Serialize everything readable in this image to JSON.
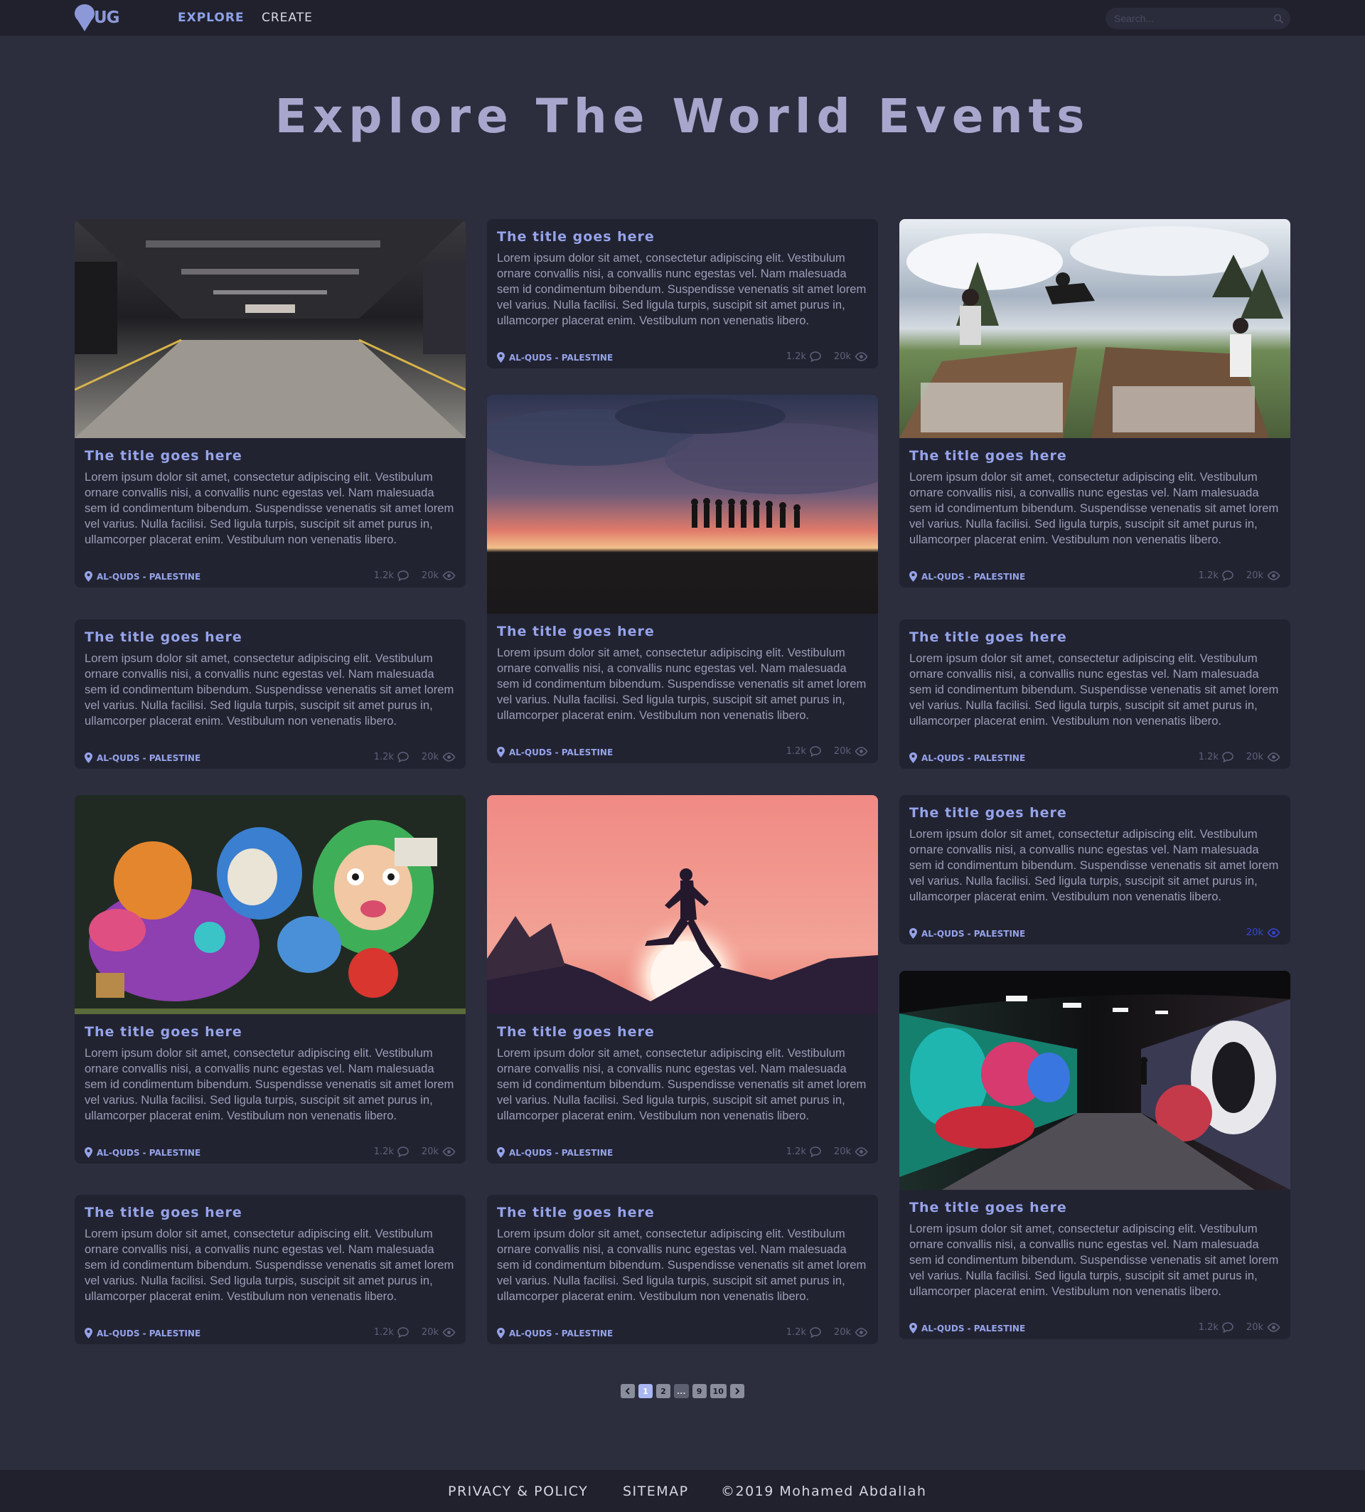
{
  "nav": {
    "brand": "UG",
    "links": [
      "EXPLORE",
      "CREATE"
    ],
    "active": "EXPLORE",
    "search_placeholder": "Search..."
  },
  "hero": {
    "title": "Explore The World Events"
  },
  "colors": {
    "background": "#2c2d3d",
    "card": "#222331",
    "accent": "#95a3ea",
    "title": "#a8a6cc",
    "highlight": "#3546d6"
  },
  "cards": [
    {
      "image": "parking-garage",
      "title": "The title goes here",
      "text": "Lorem ipsum dolor sit amet, consectetur adipiscing elit. Vestibulum ornare convallis nisi, a convallis nunc egestas vel. Nam malesuada sem id condimentum bibendum. Suspendisse venenatis sit amet lorem vel varius. Nulla facilisi. Sed ligula turpis, suscipit sit amet purus in, ullamcorper placerat enim. Vestibulum non venenatis libero.",
      "location": "AL-QUDS - PALESTINE",
      "comments": "1.2k",
      "views": "20k"
    },
    {
      "image": "",
      "title": "The title goes here",
      "text": "Lorem ipsum dolor sit amet, consectetur adipiscing elit. Vestibulum ornare convallis nisi, a convallis nunc egestas vel. Nam malesuada sem id condimentum bibendum. Suspendisse venenatis sit amet lorem vel varius. Nulla facilisi. Sed ligula turpis, suscipit sit amet purus in, ullamcorper placerat enim. Vestibulum non venenatis libero.",
      "location": "AL-QUDS - PALESTINE",
      "comments": "1.2k",
      "views": "20k"
    },
    {
      "image": "jump-park",
      "title": "The title goes here",
      "text": "Lorem ipsum dolor sit amet, consectetur adipiscing elit. Vestibulum ornare convallis nisi, a convallis nunc egestas vel. Nam malesuada sem id condimentum bibendum. Suspendisse venenatis sit amet lorem vel varius. Nulla facilisi. Sed ligula turpis, suscipit sit amet purus in, ullamcorper placerat enim. Vestibulum non venenatis libero.",
      "location": "AL-QUDS - PALESTINE",
      "comments": "1.2k",
      "views": "20k"
    },
    {
      "image": "sunset-silhouettes",
      "title": "The title goes here",
      "text": "Lorem ipsum dolor sit amet, consectetur adipiscing elit. Vestibulum ornare convallis nisi, a convallis nunc egestas vel. Nam malesuada sem id condimentum bibendum. Suspendisse venenatis sit amet lorem vel varius. Nulla facilisi. Sed ligula turpis, suscipit sit amet purus in, ullamcorper placerat enim. Vestibulum non venenatis libero.",
      "location": "AL-QUDS - PALESTINE",
      "comments": "1.2k",
      "views": "20k"
    },
    {
      "image": "",
      "title": "The title goes here",
      "text": "Lorem ipsum dolor sit amet, consectetur adipiscing elit. Vestibulum ornare convallis nisi, a convallis nunc egestas vel. Nam malesuada sem id condimentum bibendum. Suspendisse venenatis sit amet lorem vel varius. Nulla facilisi. Sed ligula turpis, suscipit sit amet purus in, ullamcorper placerat enim. Vestibulum non venenatis libero.",
      "location": "AL-QUDS - PALESTINE",
      "comments": "1.2k",
      "views": "20k"
    },
    {
      "image": "",
      "title": "The title goes here",
      "text": "Lorem ipsum dolor sit amet, consectetur adipiscing elit. Vestibulum ornare convallis nisi, a convallis nunc egestas vel. Nam malesuada sem id condimentum bibendum. Suspendisse venenatis sit amet lorem vel varius. Nulla facilisi. Sed ligula turpis, suscipit sit amet purus in, ullamcorper placerat enim. Vestibulum non venenatis libero.",
      "location": "AL-QUDS - PALESTINE",
      "comments": "1.2k",
      "views": "20k"
    },
    {
      "image": "graffiti-wall",
      "title": "The title goes here",
      "text": "Lorem ipsum dolor sit amet, consectetur adipiscing elit. Vestibulum ornare convallis nisi, a convallis nunc egestas vel. Nam malesuada sem id condimentum bibendum. Suspendisse venenatis sit amet lorem vel varius. Nulla facilisi. Sed ligula turpis, suscipit sit amet purus in, ullamcorper placerat enim. Vestibulum non venenatis libero.",
      "location": "AL-QUDS - PALESTINE",
      "comments": "1.2k",
      "views": "20k"
    },
    {
      "image": "sun-runner",
      "title": "The title goes here",
      "text": "Lorem ipsum dolor sit amet, consectetur adipiscing elit. Vestibulum ornare convallis nisi, a convallis nunc egestas vel. Nam malesuada sem id condimentum bibendum. Suspendisse venenatis sit amet lorem vel varius. Nulla facilisi. Sed ligula turpis, suscipit sit amet purus in, ullamcorper placerat enim. Vestibulum non venenatis libero.",
      "location": "AL-QUDS - PALESTINE",
      "comments": "1.2k",
      "views": "20k"
    },
    {
      "image": "",
      "title": "The title goes here",
      "text": "Lorem ipsum dolor sit amet, consectetur adipiscing elit. Vestibulum ornare convallis nisi, a convallis nunc egestas vel. Nam malesuada sem id condimentum bibendum. Suspendisse venenatis sit amet lorem vel varius. Nulla facilisi. Sed ligula turpis, suscipit sit amet purus in, ullamcorper placerat enim. Vestibulum non venenatis libero.",
      "location": "AL-QUDS - PALESTINE",
      "comments": "",
      "views": "20k"
    },
    {
      "image": "",
      "title": "The title goes here",
      "text": "Lorem ipsum dolor sit amet, consectetur adipiscing elit. Vestibulum ornare convallis nisi, a convallis nunc egestas vel. Nam malesuada sem id condimentum bibendum. Suspendisse venenatis sit amet lorem vel varius. Nulla facilisi. Sed ligula turpis, suscipit sit amet purus in, ullamcorper placerat enim. Vestibulum non venenatis libero.",
      "location": "AL-QUDS - PALESTINE",
      "comments": "1.2k",
      "views": "20k"
    },
    {
      "image": "",
      "title": "The title goes here",
      "text": "Lorem ipsum dolor sit amet, consectetur adipiscing elit. Vestibulum ornare convallis nisi, a convallis nunc egestas vel. Nam malesuada sem id condimentum bibendum. Suspendisse venenatis sit amet lorem vel varius. Nulla facilisi. Sed ligula turpis, suscipit sit amet purus in, ullamcorper placerat enim. Vestibulum non venenatis libero.",
      "location": "AL-QUDS - PALESTINE",
      "comments": "1.2k",
      "views": "20k"
    },
    {
      "image": "graffiti-tunnel",
      "title": "The title goes here",
      "text": "Lorem ipsum dolor sit amet, consectetur adipiscing elit. Vestibulum ornare convallis nisi, a convallis nunc egestas vel. Nam malesuada sem id condimentum bibendum. Suspendisse venenatis sit amet lorem vel varius. Nulla facilisi. Sed ligula turpis, suscipit sit amet purus in, ullamcorper placerat enim. Vestibulum non venenatis libero.",
      "location": "AL-QUDS - PALESTINE",
      "comments": "1.2k",
      "views": "20k"
    }
  ],
  "pagination": {
    "pages": [
      "1",
      "2",
      "...",
      "9",
      "10"
    ],
    "current": "1"
  },
  "footer": {
    "privacy": "PRIVACY & POLICY",
    "sitemap": "SITEMAP",
    "copyright": "©2019 Mohamed Abdallah"
  }
}
